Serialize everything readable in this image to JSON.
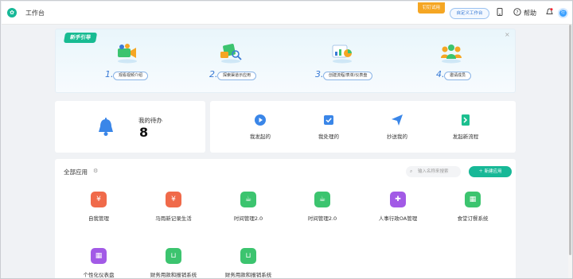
{
  "header": {
    "app_title": "工作台",
    "trial_badge": "钉钉试用",
    "customize_label": "自定义工作台",
    "help_label": "帮助",
    "avatar_text": "行"
  },
  "guide": {
    "tag": "新手引导",
    "close": "×",
    "steps": [
      {
        "num": "1.",
        "label": "观看视频介绍"
      },
      {
        "num": "2.",
        "label": "探索渠道示应用"
      },
      {
        "num": "3.",
        "label": "创建流程/表单/仪表盘"
      },
      {
        "num": "4.",
        "label": "邀请成员"
      }
    ]
  },
  "todo": {
    "label": "我的待办",
    "count": "8"
  },
  "actions": [
    {
      "label": "我发起的",
      "icon": "play-icon"
    },
    {
      "label": "我处理的",
      "icon": "check-icon"
    },
    {
      "label": "抄送我的",
      "icon": "send-icon"
    },
    {
      "label": "发起新流程",
      "icon": "new-process-icon"
    }
  ],
  "apps": {
    "title": "全部应用",
    "search_placeholder": "输入名称来搜索",
    "new_app_label": "新建应用",
    "items": [
      {
        "label": "自我管理",
        "color": "#f06a4a",
        "icon": "yen-icon",
        "glyph": "¥"
      },
      {
        "label": "马雨新记录生活",
        "color": "#f06a4a",
        "icon": "yen-icon",
        "glyph": "¥"
      },
      {
        "label": "时间管理2.0",
        "color": "#3cc46f",
        "icon": "cup-icon",
        "glyph": "☕"
      },
      {
        "label": "时间管理2.0",
        "color": "#3cc46f",
        "icon": "cup-icon",
        "glyph": "☕"
      },
      {
        "label": "人事行政OA管理",
        "color": "#a25ae6",
        "icon": "puzzle-icon",
        "glyph": "✚"
      },
      {
        "label": "食堂订餐系统",
        "color": "#3cc46f",
        "icon": "building-icon",
        "glyph": "▦"
      },
      {
        "label": "个性化仪表盘",
        "color": "#a25ae6",
        "icon": "building-icon",
        "glyph": "▦"
      },
      {
        "label": "财务用款和报销系统",
        "color": "#3cc46f",
        "icon": "basket-icon",
        "glyph": "⊔"
      },
      {
        "label": "财务用款和报销系统",
        "color": "#3cc46f",
        "icon": "basket-icon",
        "glyph": "⊔"
      }
    ]
  },
  "colors": {
    "brand": "#17b897",
    "accent": "#3a7bd5",
    "trial": "#f5a623"
  }
}
